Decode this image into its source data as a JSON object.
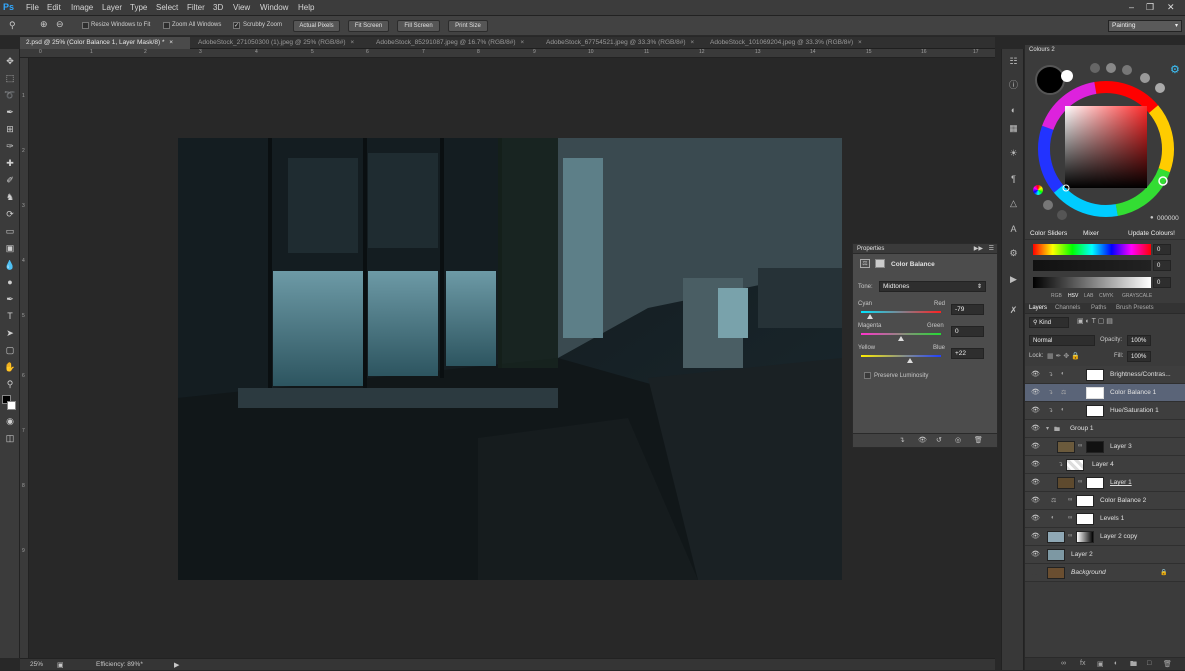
{
  "app": {
    "logo": "Ps",
    "workspace": "Painting"
  },
  "menu": [
    "File",
    "Edit",
    "Image",
    "Layer",
    "Type",
    "Select",
    "Filter",
    "3D",
    "View",
    "Window",
    "Help"
  ],
  "options": {
    "resize_windows": "Resize Windows to Fit",
    "zoom_all": "Zoom All Windows",
    "scrubby_zoom": "Scrubby Zoom",
    "actual_pixels": "Actual Pixels",
    "fit_screen": "Fit Screen",
    "fill_screen": "Fill Screen",
    "print_size": "Print Size"
  },
  "tabs": [
    "2.psd @ 25% (Color Balance 1, Layer Mask/8) *",
    "AdobeStock_271050300 (1).jpeg @ 25% (RGB/8#)",
    "AdobeStock_85291087.jpeg @ 16.7% (RGB/8#)",
    "AdobeStock_67754521.jpeg @ 33.3% (RGB/8#)",
    "AdobeStock_101069204.jpeg @ 33.3% (RGB/8#)"
  ],
  "ruler_h": [
    "0",
    "1",
    "2",
    "3",
    "4",
    "5",
    "6",
    "7",
    "8",
    "9",
    "10",
    "11",
    "12",
    "13",
    "14",
    "15",
    "16",
    "17"
  ],
  "ruler_v": [
    "1",
    "2",
    "3",
    "4",
    "5",
    "6",
    "7",
    "8",
    "9"
  ],
  "status": {
    "zoom": "25%",
    "efficiency": "Efficiency: 89%*"
  },
  "properties": {
    "panel_title": "Properties",
    "adjustment": "Color Balance",
    "tone_label": "Tone:",
    "tone": "Midtones",
    "cyan": "Cyan",
    "red": "Red",
    "cyan_red": "-79",
    "magenta": "Magenta",
    "green": "Green",
    "magenta_green": "0",
    "yellow": "Yellow",
    "blue": "Blue",
    "yellow_blue": "+22",
    "cyan_red_level": 0.11,
    "magenta_green_level": 0.5,
    "yellow_blue_level": 0.61,
    "preserve": "Preserve Luminosity"
  },
  "colours": {
    "panel_title": "Colours 2",
    "hex": "000000",
    "tabs": [
      "Color Sliders",
      "Mixer",
      "Update Colours!"
    ],
    "slider_values": [
      "0",
      "0",
      "0"
    ],
    "modes": [
      "RGB",
      "HSV",
      "LAB",
      "CMYK",
      "GRAYSCALE"
    ]
  },
  "layers_panel": {
    "tabs": [
      "Layers",
      "Channels",
      "Paths",
      "Brush Presets"
    ],
    "filter": "Kind",
    "blend": "Normal",
    "opacity_label": "Opacity:",
    "opacity": "100%",
    "lock_label": "Lock:",
    "fill_label": "Fill:",
    "fill": "100%",
    "layers": [
      "Brightness/Contras...",
      "Color Balance 1",
      "Hue/Saturation 1",
      "Group 1",
      "Layer 3",
      "Layer 4",
      "Layer 1",
      "Color Balance 2",
      "Levels 1",
      "Layer 2 copy",
      "Layer 2",
      "Background"
    ]
  }
}
